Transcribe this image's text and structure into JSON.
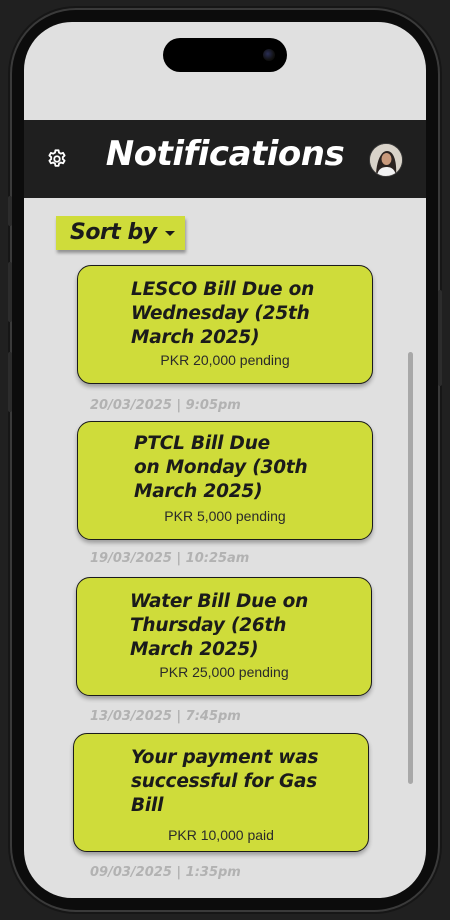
{
  "header": {
    "title": "Notifications",
    "settings_icon": "gear-icon",
    "avatar_icon": "user-avatar"
  },
  "sort": {
    "label": "Sort by",
    "icon": "caret-down-icon"
  },
  "notifications": [
    {
      "title": "LESCO Bill Due on\nWednesday (25th\nMarch 2025)",
      "amount": "PKR 20,000 pending",
      "timestamp": "20/03/2025 | 9:05pm"
    },
    {
      "title": "PTCL Bill Due\non Monday (30th\nMarch 2025)",
      "amount": "PKR 5,000 pending",
      "timestamp": "19/03/2025 | 10:25am"
    },
    {
      "title": "Water Bill Due on\nThursday (26th\nMarch 2025)",
      "amount": "PKR 25,000 pending",
      "timestamp": "13/03/2025 | 7:45pm"
    },
    {
      "title": "Your payment was\nsuccessful for Gas\nBill",
      "amount": "PKR 10,000 paid",
      "timestamp": "09/03/2025 | 1:35pm"
    }
  ],
  "colors": {
    "accent": "#cfdc3a",
    "header_bg": "#1f1f1f",
    "screen_bg": "#e0e0e0",
    "timestamp": "#b2b2b2"
  }
}
